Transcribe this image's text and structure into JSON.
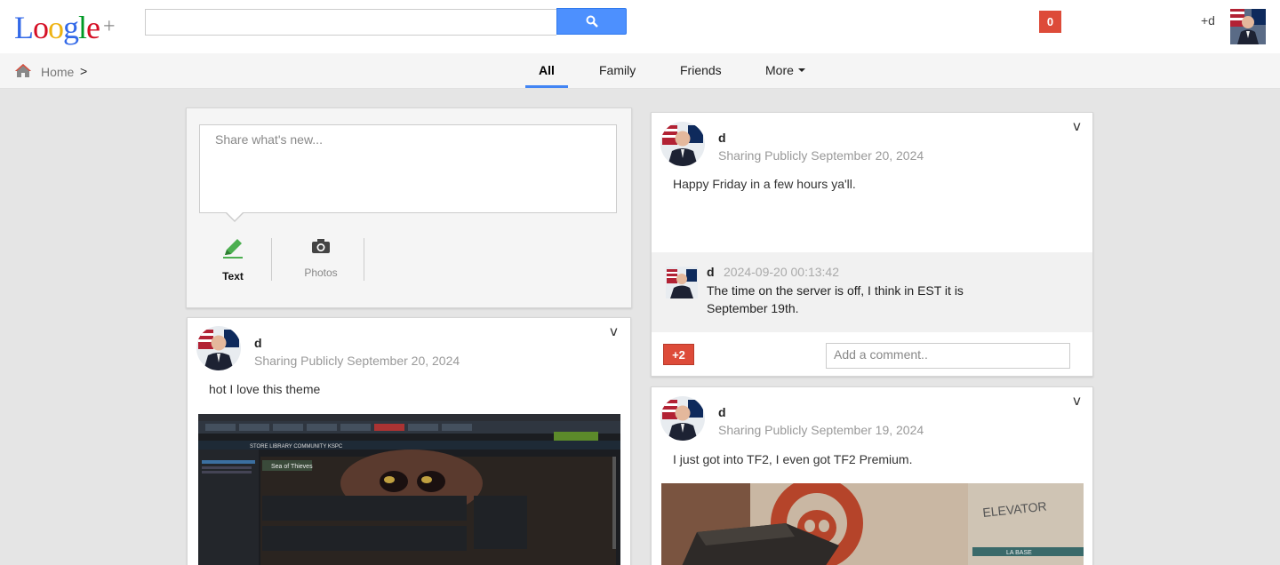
{
  "app": {
    "logo": [
      "L",
      "o",
      "o",
      "g",
      "l",
      "e"
    ],
    "logo_plus": "+",
    "notifications": "0",
    "plus_name": "+d"
  },
  "search": {
    "placeholder": "",
    "value": ""
  },
  "nav": {
    "breadcrumb_home": "Home",
    "breadcrumb_sep": ">",
    "tabs": [
      {
        "label": "All",
        "active": true
      },
      {
        "label": "Family"
      },
      {
        "label": "Friends"
      },
      {
        "label": "More"
      }
    ]
  },
  "composer": {
    "placeholder": "Share what's new...",
    "options": [
      {
        "label": "Text",
        "icon": "pencil-icon",
        "active": true
      },
      {
        "label": "Photos",
        "icon": "camera-icon"
      }
    ]
  },
  "posts": [
    {
      "author": "d",
      "visibility": "Sharing Publicly",
      "date": "September 20, 2024",
      "text": "hot I love this theme",
      "image": "steam-library-screenshot"
    },
    {
      "author": "d",
      "visibility": "Sharing Publicly",
      "date": "September 20, 2024",
      "text": "Happy Friday in a few hours ya'll.",
      "comment": {
        "author": "d",
        "time": "2024-09-20 00:13:42",
        "text": "The time on the server is off, I think in EST it is September 19th."
      },
      "plus_count": "+2",
      "comment_placeholder": "Add a comment.."
    },
    {
      "author": "d",
      "visibility": "Sharing Publicly",
      "date": "September 19, 2024",
      "text": "I just got into TF2, I even got TF2 Premium.",
      "image": "tf2-map-screenshot"
    }
  ],
  "colors": {
    "accent": "#4285f4",
    "search_button": "#4d90fe",
    "badge": "#dd4b39"
  }
}
